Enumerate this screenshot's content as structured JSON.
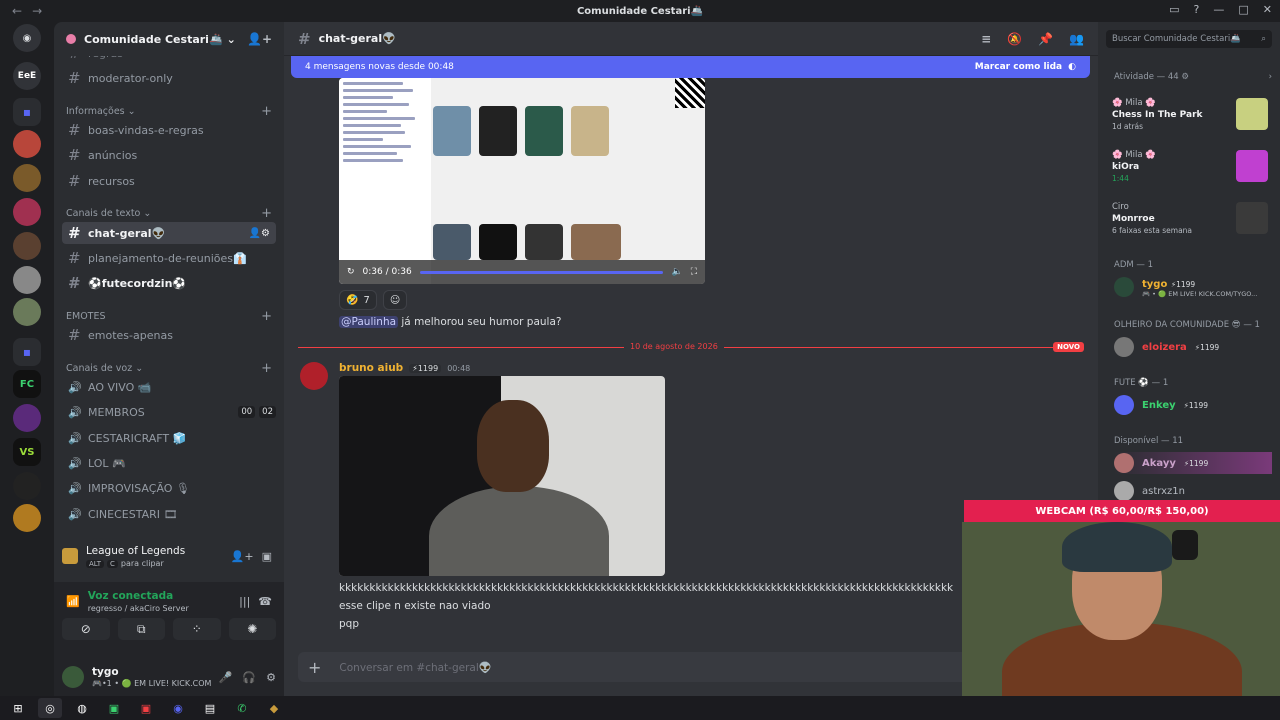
{
  "window": {
    "title": "Comunidade Cestari🚢"
  },
  "servers": {
    "eee_label": "EeE",
    "fc_label": "FC",
    "vs_label": "VS"
  },
  "sidebar": {
    "server_name": "Comunidade Cestari🚢",
    "top_partial": "regras",
    "items": [
      {
        "label": "moderator-only"
      },
      {
        "label": "boas-vindas-e-regras"
      },
      {
        "label": "anúncios"
      },
      {
        "label": "recursos"
      },
      {
        "label": "chat-geral👽"
      },
      {
        "label": "planejamento-de-reuniões👔"
      },
      {
        "label": "⚽futecordzin⚽"
      },
      {
        "label": "emotes-apenas"
      }
    ],
    "categories": {
      "info": "Informações",
      "text": "Canais de texto",
      "emotes": "EMOTES",
      "voice": "Canais de voz"
    },
    "voice_channels": [
      {
        "label": "AO VIVO 📹"
      },
      {
        "label": "MEMBROS",
        "c1": "00",
        "c2": "02"
      },
      {
        "label": "CESTARICRAFT 🧊"
      },
      {
        "label": "LOL 🎮"
      },
      {
        "label": "IMPROVISAÇÃO 🎙"
      },
      {
        "label": "CINECESTARI 🎞"
      }
    ],
    "activity": {
      "title": "League of Legends",
      "kbd1": "ALT",
      "kbd2": "C",
      "sub": "para clipar"
    },
    "voice": {
      "status": "Voz conectada",
      "location": "regresso / akaCiro Server"
    },
    "user": {
      "name": "tygo",
      "status": "🎮•1 • 🟢 EM LIVE! KICK.COM/T..."
    }
  },
  "channel": {
    "name": "chat-geral👽",
    "new_bar": "4 mensagens novas desde 00:48",
    "mark_read": "Marcar como lida"
  },
  "messages": {
    "video1_time": "0:36 / 0:36",
    "reaction_count": "7",
    "mention": "@Paulinha",
    "reply_text": "já melhorou seu humor paula?",
    "divider_date": "10 de agosto de 2026",
    "novo": "NOVO",
    "author": "bruno aiub",
    "author_tag": "⚡1199",
    "time": "00:48",
    "line1": "kkkkkkkkkkkkkkkkkkkkkkkkkkkkkkkkkkkkkkkkkkkkkkkkkkkkkkkkkkkkkkkkkkkkkkkkkkkkkkkkkkkkkkkkkkkkkkkkkkkkk",
    "line2": "esse clipe n existe nao viado",
    "line3": "pqp",
    "composer_placeholder": "Conversar em #chat-geral👽"
  },
  "members": {
    "search_placeholder": "Buscar Comunidade Cestari🚢",
    "activity_header": "Atividade — 44",
    "activities": [
      {
        "name": "🌸 Mila 🌸",
        "title": "Chess In The Park",
        "sub": "1d atrás"
      },
      {
        "name": "🌸 Mila 🌸",
        "title": "kiOra",
        "sub": "1:44"
      },
      {
        "name": "Ciro",
        "title": "Monrroe",
        "sub": "6 faixas esta semana"
      }
    ],
    "groups": [
      {
        "header": "ADM — 1"
      },
      {
        "header": "OLHEIRO DA COMUNIDADE 😎 — 1"
      },
      {
        "header": "FUTE ⚽ — 1"
      },
      {
        "header": "Disponível — 11"
      }
    ],
    "list": [
      {
        "name": "tygo",
        "tag": "⚡1199",
        "status": "🎮 • 🟢 EM LIVE! KICK.COM/TYGO..."
      },
      {
        "name": "eloizera",
        "tag": "⚡1199"
      },
      {
        "name": "Enkey",
        "tag": "⚡1199"
      },
      {
        "name": "Akayy",
        "tag": "⚡1199"
      },
      {
        "name": "astrxz1n"
      }
    ]
  },
  "webcam": {
    "banner": "WEBCAM (R$ 60,00/R$ 150,00)"
  }
}
